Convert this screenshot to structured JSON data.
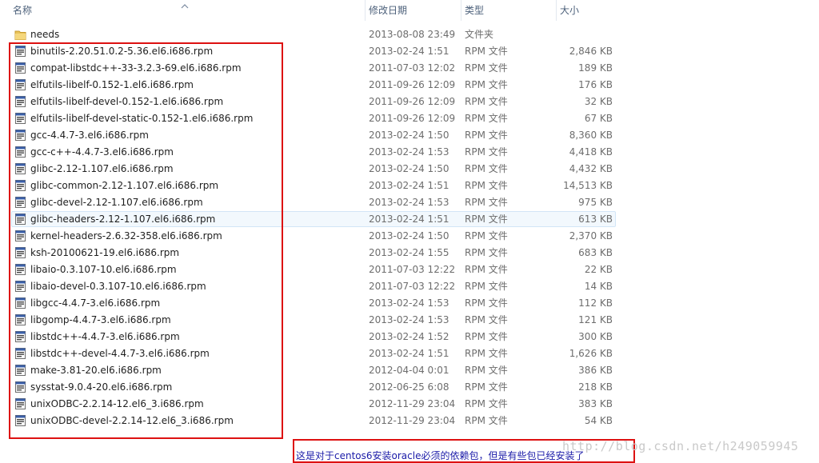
{
  "columns": {
    "name": "名称",
    "date": "修改日期",
    "type": "类型",
    "size": "大小"
  },
  "files": [
    {
      "name": "needs",
      "date": "2013-08-08 23:49",
      "type": "文件夹",
      "size": "",
      "icon": "folder-icon"
    },
    {
      "name": "binutils-2.20.51.0.2-5.36.el6.i686.rpm",
      "date": "2013-02-24 1:51",
      "type": "RPM 文件",
      "size": "2,846 KB",
      "icon": "rpm-file-icon"
    },
    {
      "name": "compat-libstdc++-33-3.2.3-69.el6.i686.rpm",
      "date": "2011-07-03 12:02",
      "type": "RPM 文件",
      "size": "189 KB",
      "icon": "rpm-file-icon"
    },
    {
      "name": "elfutils-libelf-0.152-1.el6.i686.rpm",
      "date": "2011-09-26 12:09",
      "type": "RPM 文件",
      "size": "176 KB",
      "icon": "rpm-file-icon"
    },
    {
      "name": "elfutils-libelf-devel-0.152-1.el6.i686.rpm",
      "date": "2011-09-26 12:09",
      "type": "RPM 文件",
      "size": "32 KB",
      "icon": "rpm-file-icon"
    },
    {
      "name": "elfutils-libelf-devel-static-0.152-1.el6.i686.rpm",
      "date": "2011-09-26 12:09",
      "type": "RPM 文件",
      "size": "67 KB",
      "icon": "rpm-file-icon"
    },
    {
      "name": "gcc-4.4.7-3.el6.i686.rpm",
      "date": "2013-02-24 1:50",
      "type": "RPM 文件",
      "size": "8,360 KB",
      "icon": "rpm-file-icon"
    },
    {
      "name": "gcc-c++-4.4.7-3.el6.i686.rpm",
      "date": "2013-02-24 1:53",
      "type": "RPM 文件",
      "size": "4,418 KB",
      "icon": "rpm-file-icon"
    },
    {
      "name": "glibc-2.12-1.107.el6.i686.rpm",
      "date": "2013-02-24 1:50",
      "type": "RPM 文件",
      "size": "4,432 KB",
      "icon": "rpm-file-icon"
    },
    {
      "name": "glibc-common-2.12-1.107.el6.i686.rpm",
      "date": "2013-02-24 1:51",
      "type": "RPM 文件",
      "size": "14,513 KB",
      "icon": "rpm-file-icon"
    },
    {
      "name": "glibc-devel-2.12-1.107.el6.i686.rpm",
      "date": "2013-02-24 1:53",
      "type": "RPM 文件",
      "size": "975 KB",
      "icon": "rpm-file-icon"
    },
    {
      "name": "glibc-headers-2.12-1.107.el6.i686.rpm",
      "date": "2013-02-24 1:51",
      "type": "RPM 文件",
      "size": "613 KB",
      "icon": "rpm-file-icon",
      "hover": true
    },
    {
      "name": "kernel-headers-2.6.32-358.el6.i686.rpm",
      "date": "2013-02-24 1:50",
      "type": "RPM 文件",
      "size": "2,370 KB",
      "icon": "rpm-file-icon"
    },
    {
      "name": "ksh-20100621-19.el6.i686.rpm",
      "date": "2013-02-24 1:55",
      "type": "RPM 文件",
      "size": "683 KB",
      "icon": "rpm-file-icon"
    },
    {
      "name": "libaio-0.3.107-10.el6.i686.rpm",
      "date": "2011-07-03 12:22",
      "type": "RPM 文件",
      "size": "22 KB",
      "icon": "rpm-file-icon"
    },
    {
      "name": "libaio-devel-0.3.107-10.el6.i686.rpm",
      "date": "2011-07-03 12:22",
      "type": "RPM 文件",
      "size": "14 KB",
      "icon": "rpm-file-icon"
    },
    {
      "name": "libgcc-4.4.7-3.el6.i686.rpm",
      "date": "2013-02-24 1:53",
      "type": "RPM 文件",
      "size": "112 KB",
      "icon": "rpm-file-icon"
    },
    {
      "name": "libgomp-4.4.7-3.el6.i686.rpm",
      "date": "2013-02-24 1:53",
      "type": "RPM 文件",
      "size": "121 KB",
      "icon": "rpm-file-icon"
    },
    {
      "name": "libstdc++-4.4.7-3.el6.i686.rpm",
      "date": "2013-02-24 1:52",
      "type": "RPM 文件",
      "size": "300 KB",
      "icon": "rpm-file-icon"
    },
    {
      "name": "libstdc++-devel-4.4.7-3.el6.i686.rpm",
      "date": "2013-02-24 1:51",
      "type": "RPM 文件",
      "size": "1,626 KB",
      "icon": "rpm-file-icon"
    },
    {
      "name": "make-3.81-20.el6.i686.rpm",
      "date": "2012-04-04 0:01",
      "type": "RPM 文件",
      "size": "386 KB",
      "icon": "rpm-file-icon"
    },
    {
      "name": "sysstat-9.0.4-20.el6.i686.rpm",
      "date": "2012-06-25 6:08",
      "type": "RPM 文件",
      "size": "218 KB",
      "icon": "rpm-file-icon"
    },
    {
      "name": "unixODBC-2.2.14-12.el6_3.i686.rpm",
      "date": "2012-11-29 23:04",
      "type": "RPM 文件",
      "size": "383 KB",
      "icon": "rpm-file-icon"
    },
    {
      "name": "unixODBC-devel-2.2.14-12.el6_3.i686.rpm",
      "date": "2012-11-29 23:04",
      "type": "RPM 文件",
      "size": "54 KB",
      "icon": "rpm-file-icon"
    }
  ],
  "annotation": {
    "caption": "这是对于centos6安装oracle必须的依赖包，但是有些包已经安装了",
    "box_color": "#dd1111",
    "caption_color": "#1a1aa8"
  },
  "watermark": "http://blog.csdn.net/h249059945"
}
